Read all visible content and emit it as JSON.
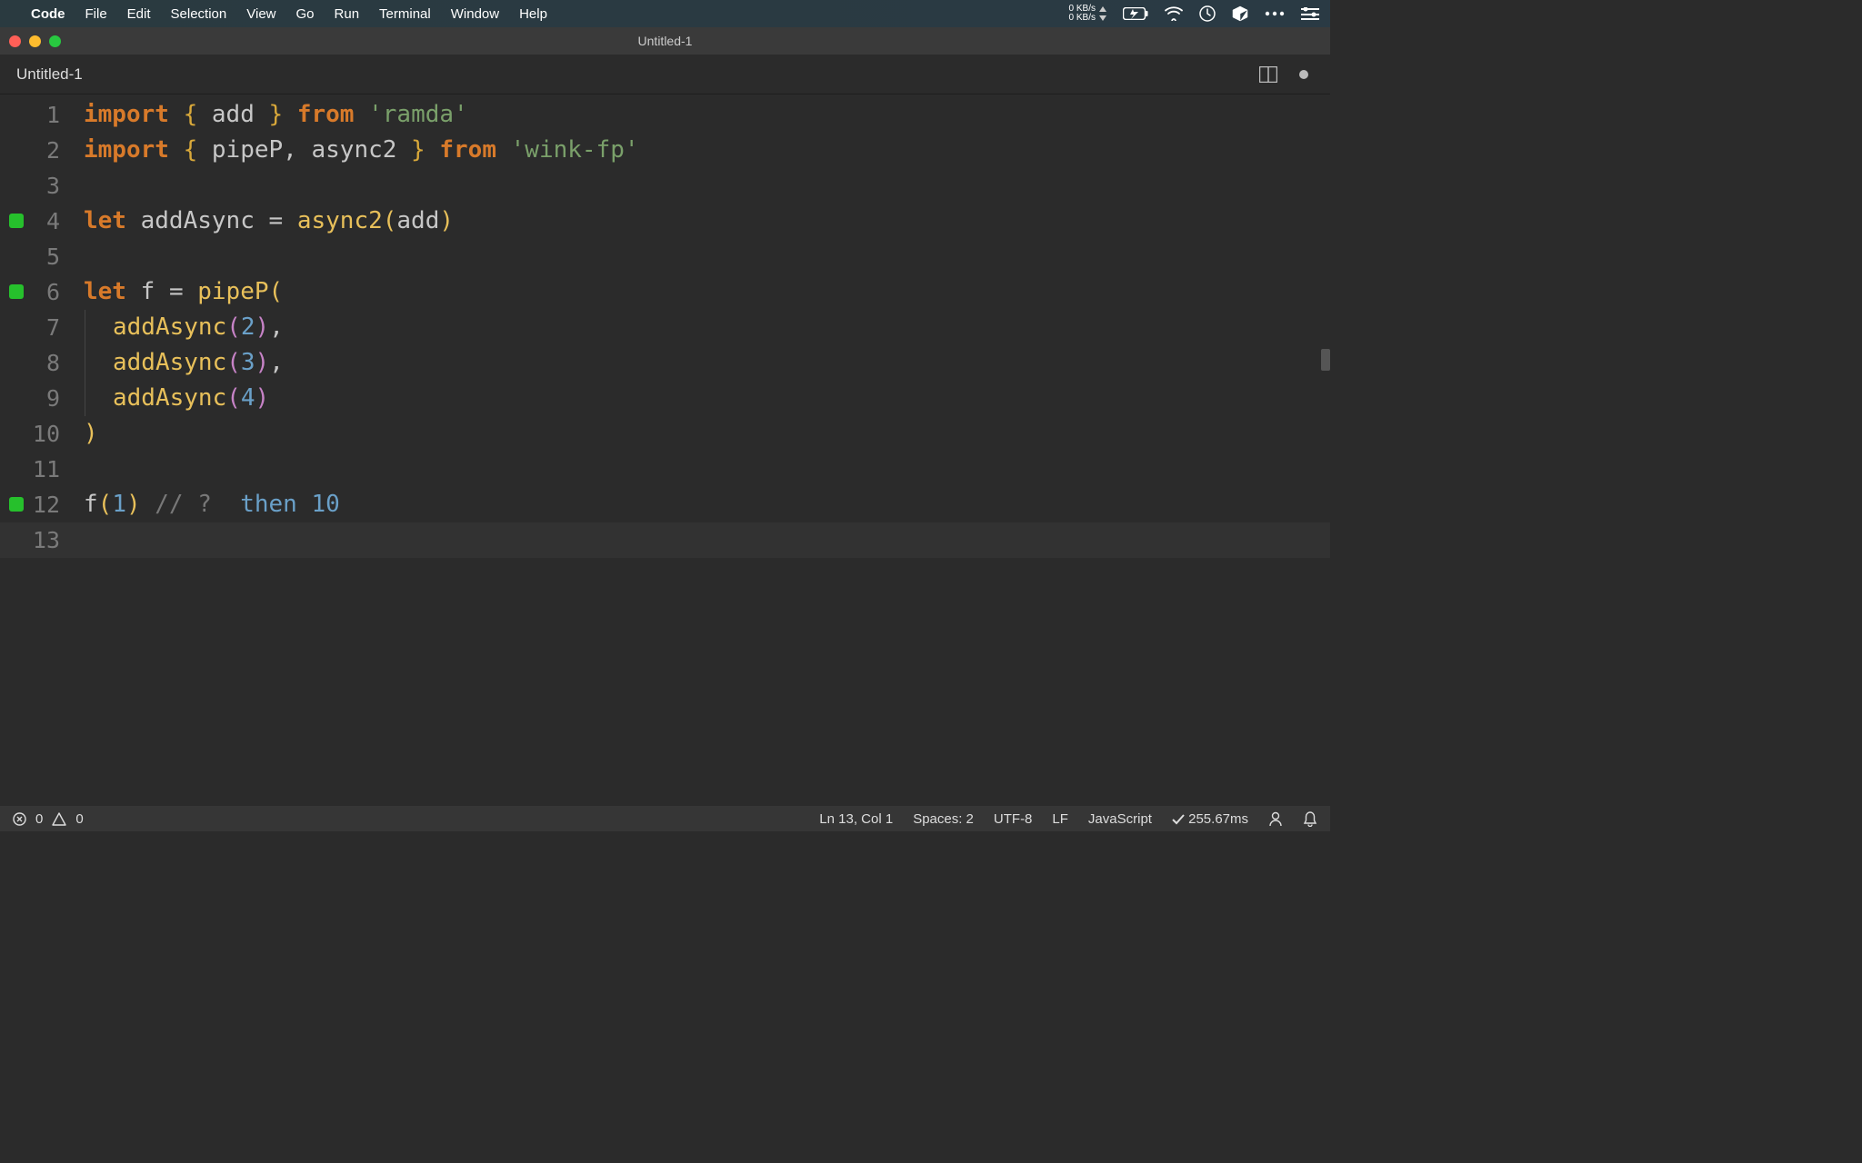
{
  "menubar": {
    "app": "Code",
    "items": [
      "File",
      "Edit",
      "Selection",
      "View",
      "Go",
      "Run",
      "Terminal",
      "Window",
      "Help"
    ],
    "net_up": "0 KB/s",
    "net_down": "0 KB/s"
  },
  "window": {
    "title": "Untitled-1"
  },
  "tabs": [
    {
      "label": "Untitled-1",
      "dirty": true
    }
  ],
  "editor": {
    "breakpoints": [
      4,
      6,
      12
    ],
    "current_line": 13,
    "lines": [
      {
        "n": 1,
        "tokens": [
          {
            "t": "import ",
            "c": "kw"
          },
          {
            "t": "{ ",
            "c": "brace"
          },
          {
            "t": "add",
            "c": "ident"
          },
          {
            "t": " } ",
            "c": "brace"
          },
          {
            "t": "from ",
            "c": "kw"
          },
          {
            "t": "'ramda'",
            "c": "str"
          }
        ]
      },
      {
        "n": 2,
        "tokens": [
          {
            "t": "import ",
            "c": "kw"
          },
          {
            "t": "{ ",
            "c": "brace"
          },
          {
            "t": "pipeP",
            "c": "ident"
          },
          {
            "t": ", ",
            "c": "op"
          },
          {
            "t": "async2",
            "c": "ident"
          },
          {
            "t": " } ",
            "c": "brace"
          },
          {
            "t": "from ",
            "c": "kw"
          },
          {
            "t": "'wink-fp'",
            "c": "str"
          }
        ]
      },
      {
        "n": 3,
        "tokens": []
      },
      {
        "n": 4,
        "tokens": [
          {
            "t": "let ",
            "c": "let-kw"
          },
          {
            "t": "addAsync ",
            "c": "ident"
          },
          {
            "t": "= ",
            "c": "op"
          },
          {
            "t": "async2",
            "c": "fn"
          },
          {
            "t": "(",
            "c": "paren-y"
          },
          {
            "t": "add",
            "c": "ident"
          },
          {
            "t": ")",
            "c": "paren-y"
          }
        ]
      },
      {
        "n": 5,
        "tokens": []
      },
      {
        "n": 6,
        "tokens": [
          {
            "t": "let ",
            "c": "let-kw"
          },
          {
            "t": "f ",
            "c": "ident"
          },
          {
            "t": "= ",
            "c": "op"
          },
          {
            "t": "pipeP",
            "c": "fn"
          },
          {
            "t": "(",
            "c": "paren-y"
          }
        ]
      },
      {
        "n": 7,
        "indent": true,
        "tokens": [
          {
            "t": "addAsync",
            "c": "call"
          },
          {
            "t": "(",
            "c": "paren-p"
          },
          {
            "t": "2",
            "c": "num"
          },
          {
            "t": ")",
            "c": "paren-p"
          },
          {
            "t": ",",
            "c": "op"
          }
        ]
      },
      {
        "n": 8,
        "indent": true,
        "tokens": [
          {
            "t": "addAsync",
            "c": "call"
          },
          {
            "t": "(",
            "c": "paren-p"
          },
          {
            "t": "3",
            "c": "num"
          },
          {
            "t": ")",
            "c": "paren-p"
          },
          {
            "t": ",",
            "c": "op"
          }
        ]
      },
      {
        "n": 9,
        "indent": true,
        "tokens": [
          {
            "t": "addAsync",
            "c": "call"
          },
          {
            "t": "(",
            "c": "paren-p"
          },
          {
            "t": "4",
            "c": "num"
          },
          {
            "t": ")",
            "c": "paren-p"
          }
        ]
      },
      {
        "n": 10,
        "tokens": [
          {
            "t": ")",
            "c": "paren-y"
          }
        ]
      },
      {
        "n": 11,
        "tokens": []
      },
      {
        "n": 12,
        "tokens": [
          {
            "t": "f",
            "c": "ident"
          },
          {
            "t": "(",
            "c": "paren-y"
          },
          {
            "t": "1",
            "c": "num"
          },
          {
            "t": ")",
            "c": "paren-y"
          },
          {
            "t": " ",
            "c": "op"
          },
          {
            "t": "// ?  ",
            "c": "comment"
          },
          {
            "t": "then ",
            "c": "num"
          },
          {
            "t": "10",
            "c": "num"
          }
        ]
      },
      {
        "n": 13,
        "tokens": []
      }
    ]
  },
  "statusbar": {
    "errors": "0",
    "warnings": "0",
    "cursor": "Ln 13, Col 1",
    "spaces": "Spaces: 2",
    "encoding": "UTF-8",
    "eol": "LF",
    "language": "JavaScript",
    "quokka": "255.67ms"
  }
}
